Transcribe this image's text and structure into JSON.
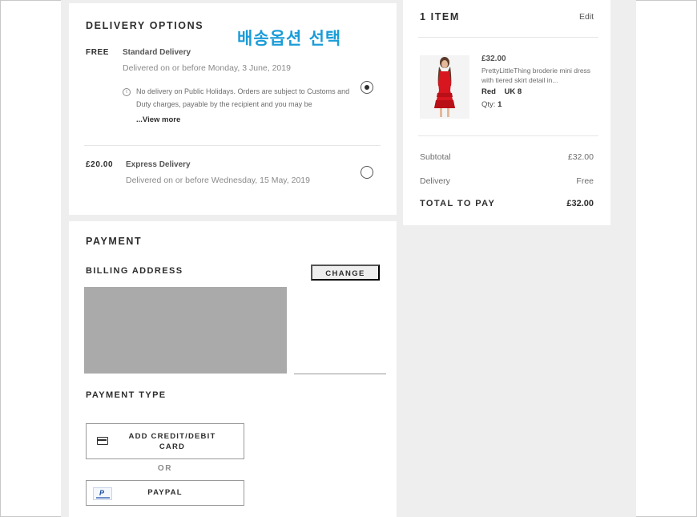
{
  "delivery": {
    "heading": "DELIVERY OPTIONS",
    "annotation_korean": "배송옵션 선택",
    "options": [
      {
        "price": "FREE",
        "name": "Standard Delivery",
        "date": "Delivered on or before Monday, 3 June, 2019",
        "note": "No delivery on Public Holidays. Orders are subject to Customs and Duty charges, payable by the recipient and you may be",
        "view_more": "...View more",
        "selected": true
      },
      {
        "price": "£20.00",
        "name": "Express Delivery",
        "date": "Delivered on or before Wednesday, 15 May, 2019",
        "selected": false
      }
    ]
  },
  "payment": {
    "heading": "PAYMENT",
    "billing_heading": "BILLING ADDRESS",
    "change_label": "CHANGE",
    "payment_type_heading": "PAYMENT TYPE",
    "add_card_label": "ADD CREDIT/DEBIT CARD",
    "or_label": "OR",
    "paypal_label": "PAYPAL",
    "paypal_icon_text": "P"
  },
  "summary": {
    "heading": "1 ITEM",
    "edit_label": "Edit",
    "item": {
      "price": "£32.00",
      "description": "PrettyLittleThing broderie mini dress with tiered skirt detail in...",
      "color": "Red",
      "size": "UK 8",
      "qty_label": "Qty:",
      "qty_value": "1"
    },
    "subtotal_label": "Subtotal",
    "subtotal_value": "£32.00",
    "delivery_label": "Delivery",
    "delivery_value": "Free",
    "total_label": "TOTAL TO PAY",
    "total_value": "£32.00"
  },
  "colors": {
    "background": "#eeeeee",
    "card": "#ffffff",
    "text": "#2d2d2d",
    "annotation": "#1a9cd8",
    "dress": "#d7161f"
  },
  "icons": [
    "info-icon",
    "radio-selected-icon",
    "radio-empty-icon",
    "credit-card-icon",
    "paypal-icon"
  ]
}
